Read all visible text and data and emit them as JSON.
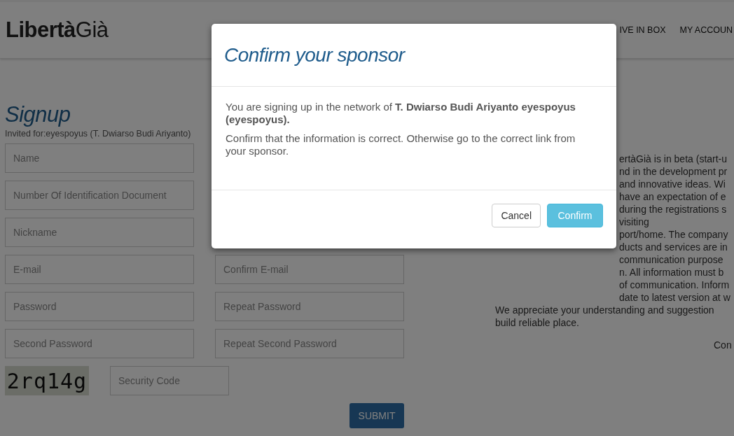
{
  "header": {
    "logo": "**Libertà**Già",
    "nav": [
      "IVE IN BOX",
      "MY ACCOUN"
    ]
  },
  "signup": {
    "title": "Signup",
    "invited": "Invited for:eyespoyus (T. Dwiarso Budi Ariyanto)",
    "rows": [
      {
        "fields": [
          {
            "placeholder": "Name"
          }
        ]
      },
      {
        "fields": [
          {
            "placeholder": "Number Of Identification Document"
          }
        ]
      },
      {
        "fields": [
          {
            "placeholder": "Nickname"
          }
        ]
      },
      {
        "fields": [
          {
            "placeholder": "E-mail"
          },
          {
            "placeholder": "Confirm E-mail"
          }
        ]
      },
      {
        "fields": [
          {
            "placeholder": "Password"
          },
          {
            "placeholder": "Repeat Password"
          }
        ]
      },
      {
        "fields": [
          {
            "placeholder": "Second Password"
          },
          {
            "placeholder": "Repeat Second Password"
          }
        ]
      }
    ],
    "captcha": "2rq14g",
    "security_code": {
      "placeholder": "Security Code"
    },
    "submit": "SUBMIT"
  },
  "notice": {
    "covered_lines": [
      "ertàGià is in beta (start-u",
      "nd in the development pr",
      "and innovative ideas. Wi",
      "have an expectation of e",
      "during the registrations s",
      "visiting",
      "port/home. The company",
      "ducts and services are in",
      "communication purpose",
      "n. All information must b",
      "of communication. Inform",
      "date to latest version at w"
    ],
    "lines": [
      "We appreciate your understanding and suggestion",
      "build reliable place."
    ],
    "signature": "Con"
  },
  "modal": {
    "title": "Confirm your sponsor",
    "message": "You are signing up in the network of **T. Dwiarso Budi Ariyanto eyespoyus (eyespoyus).**",
    "note": "Confirm that the information is correct. Otherwise go to the correct link from your sponsor.",
    "buttons": [
      {
        "label": "Cancel",
        "kind": "default"
      },
      {
        "label": "Confirm",
        "kind": "primary"
      }
    ]
  }
}
